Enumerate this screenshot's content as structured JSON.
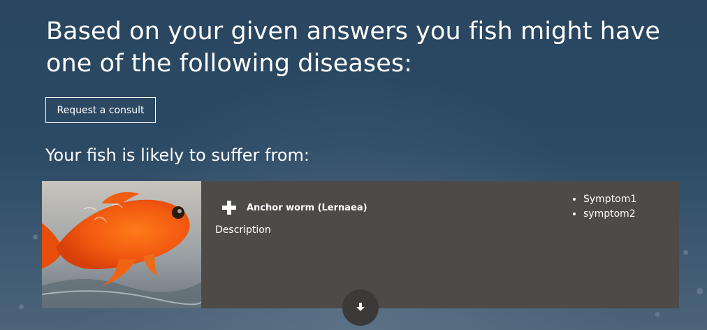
{
  "results": {
    "heading": "Based on your given answers you fish might have one of the following diseases:",
    "consult_button_label": "Request a consult",
    "subheading": "Your fish is likely to suffer from:"
  },
  "disease": {
    "name": "Anchor worm (Lernaea)",
    "description": "Description",
    "symptoms": [
      "Symptom1",
      "symptom2"
    ],
    "card_color": "#4d4a48"
  },
  "icons": {
    "expand": "plus-icon",
    "scroll": "arrow-down-icon"
  }
}
